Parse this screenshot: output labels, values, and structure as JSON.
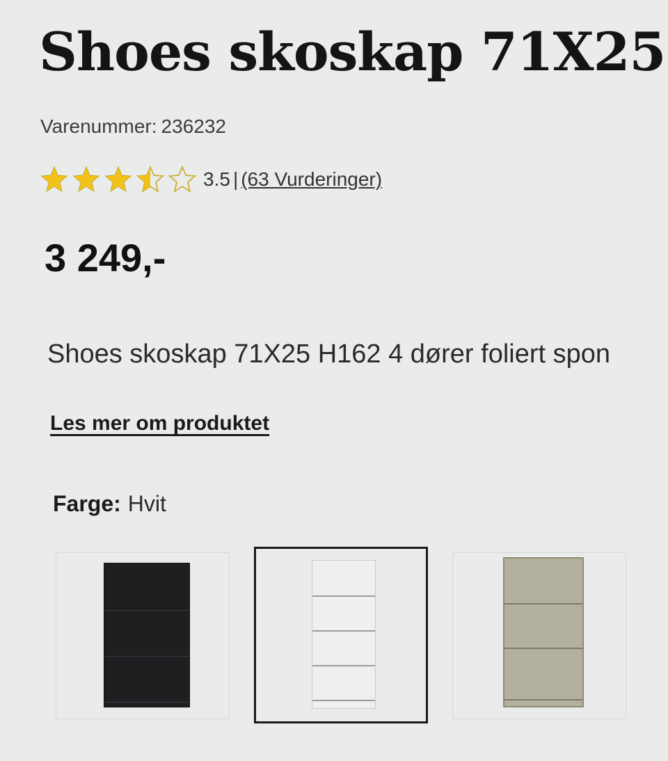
{
  "product": {
    "title": "Shoes skoskap 71X25",
    "sku_label": "Varenummer:",
    "sku": "236232",
    "rating_value": "3.5",
    "rating_stars": 3.5,
    "rating_max": 5,
    "rating_separator": "|",
    "reviews_link": "(63 Vurderinger)",
    "price": "3 249,-",
    "description": "Shoes skoskap 71X25 H162 4 dører foliert spon",
    "read_more": "Les mer om produktet",
    "color_label": "Farge:",
    "color_value": "Hvit"
  },
  "variants": [
    {
      "name": "black-variant",
      "selected": false,
      "color": "#1e1f21"
    },
    {
      "name": "white-variant",
      "selected": true,
      "color": "#eef0ee"
    },
    {
      "name": "oak-variant",
      "selected": false,
      "color": "#b4b09e"
    }
  ],
  "colors": {
    "star_fill": "#f2c21b",
    "star_empty": "#c9a820",
    "selected_border": "#1a1a1a"
  },
  "icons": {
    "star": "star-icon",
    "half_star": "half-star-icon",
    "empty_star": "empty-star-icon"
  }
}
